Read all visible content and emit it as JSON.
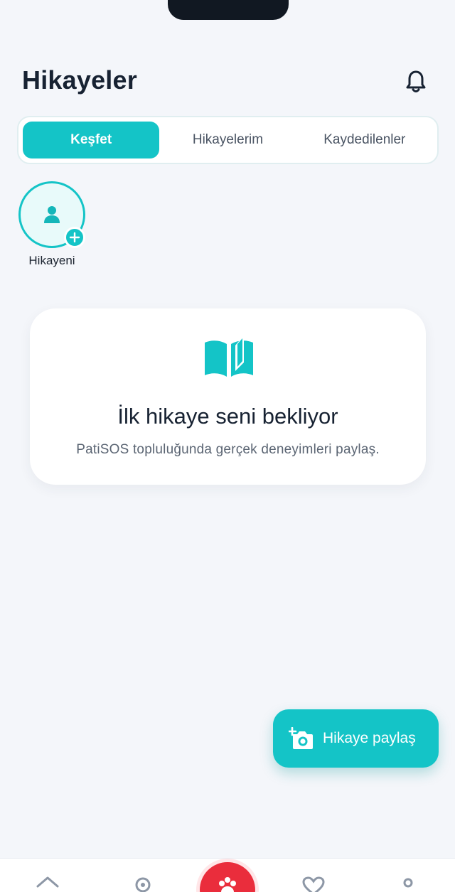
{
  "header": {
    "title": "Hikayeler",
    "bell_icon": "bell-icon"
  },
  "tabs": [
    {
      "label": "Keşfet",
      "active": true
    },
    {
      "label": "Hikayelerim",
      "active": false
    },
    {
      "label": "Kaydedilenler",
      "active": false
    }
  ],
  "stories": {
    "add_label": "Hikayeni"
  },
  "empty_state": {
    "icon": "open-book-icon",
    "title": "İlk hikaye seni bekliyor",
    "subtitle": "PatiSOS topluluğunda gerçek deneyimleri paylaş."
  },
  "fab": {
    "label": "Hikaye paylaş",
    "icon": "add-camera-icon"
  },
  "bottom_nav": {
    "items": [
      "home-icon",
      "location-pin-icon",
      "paw-icon",
      "heart-icon",
      "profile-icon"
    ]
  },
  "colors": {
    "accent": "#14c4c7",
    "danger": "#ea2d3c",
    "text": "#172232"
  }
}
